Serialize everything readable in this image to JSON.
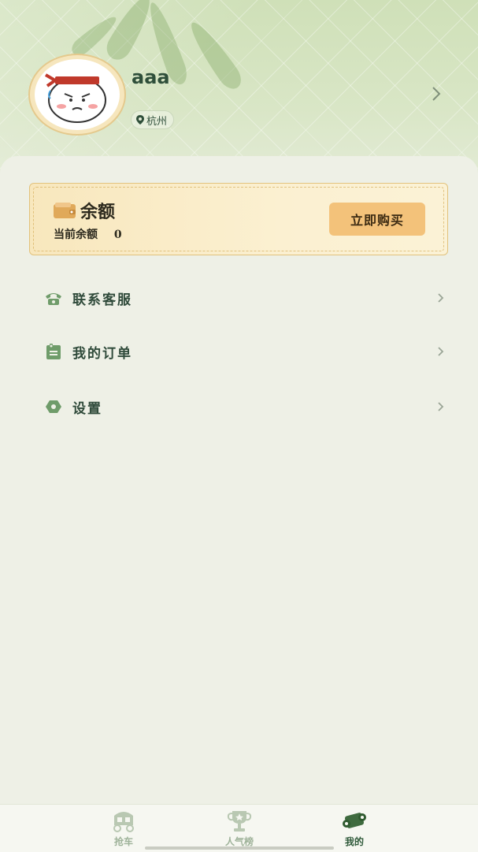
{
  "profile": {
    "username": "aaa",
    "location": "杭州"
  },
  "balance": {
    "title": "余额",
    "current_label": "当前余额",
    "current_value": "0",
    "buy_label": "立即购买"
  },
  "menu": {
    "items": [
      {
        "label": "联系客服",
        "icon": "phone-icon"
      },
      {
        "label": "我的订单",
        "icon": "order-icon"
      },
      {
        "label": "设置",
        "icon": "settings-icon"
      }
    ]
  },
  "tabbar": {
    "tabs": [
      {
        "label": "抢车",
        "icon": "carriage-icon",
        "active": false
      },
      {
        "label": "人气榜",
        "icon": "trophy-icon",
        "active": false
      },
      {
        "label": "我的",
        "icon": "scroll-icon",
        "active": true
      }
    ]
  },
  "colors": {
    "accent": "#2f5a3a",
    "button": "#f3c27a",
    "inactive_tab": "#9fb39a"
  }
}
